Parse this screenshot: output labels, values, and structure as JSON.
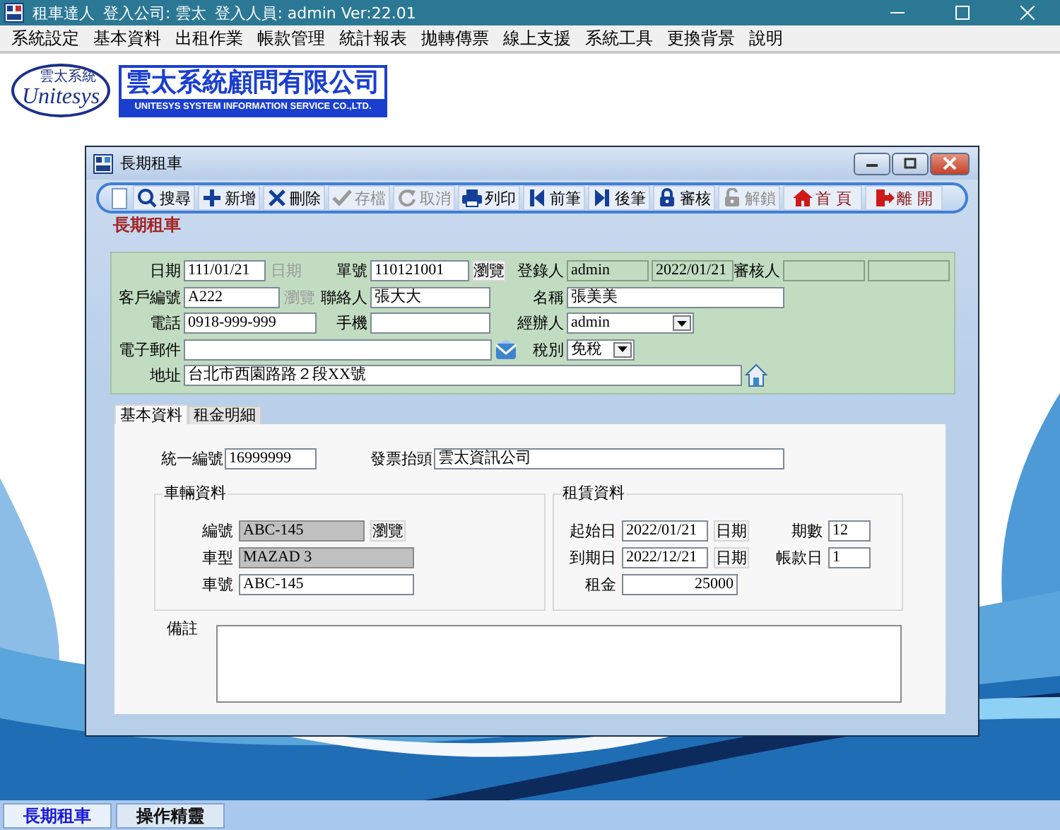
{
  "app": {
    "title": "租車達人",
    "company": "登入公司: 雲太",
    "user": "登入人員: admin Ver:22.01"
  },
  "menu": [
    "系統設定",
    "基本資料",
    "出租作業",
    "帳款管理",
    "統計報表",
    "拋轉傳票",
    "線上支援",
    "系統工具",
    "更換背景",
    "說明"
  ],
  "logo": {
    "badge": "雲太系統",
    "script": "Unitesys",
    "name": "雲太系統顧問有限公司",
    "subtitle": "UNITESYS SYSTEM INFORMATION SERVICE CO.,LTD."
  },
  "window": {
    "title": "長期租車"
  },
  "toolbar": {
    "items": [
      {
        "label": "搜尋",
        "disabled": false
      },
      {
        "label": "新增",
        "disabled": false
      },
      {
        "label": "刪除",
        "disabled": false
      },
      {
        "label": "存檔",
        "disabled": true
      },
      {
        "label": "取消",
        "disabled": true
      },
      {
        "label": "列印",
        "disabled": false
      },
      {
        "label": "前筆",
        "disabled": false
      },
      {
        "label": "後筆",
        "disabled": false
      },
      {
        "label": "審核",
        "disabled": false
      },
      {
        "label": "解鎖",
        "disabled": true
      }
    ],
    "nav": [
      {
        "label": "首 頁"
      },
      {
        "label": "離 開"
      }
    ]
  },
  "heading": "長期租車",
  "header": {
    "rows": [
      {
        "fields": [
          {
            "label": "日期",
            "controls": [
              {
                "kind": "input",
                "value": "111/01/21",
                "readonly": false
              },
              {
                "kind": "button",
                "label": "日期",
                "disabled": true
              }
            ]
          },
          {
            "label": "單號",
            "controls": [
              {
                "kind": "input",
                "value": "110121001",
                "readonly": false
              },
              {
                "kind": "button",
                "label": "瀏覽",
                "disabled": false
              }
            ]
          },
          {
            "label": "登錄人",
            "controls": [
              {
                "kind": "input",
                "value": "admin",
                "readonly": true
              },
              {
                "kind": "input",
                "value": "2022/01/21",
                "readonly": true
              }
            ]
          },
          {
            "label": "審核人",
            "controls": [
              {
                "kind": "input",
                "readonly": true
              },
              {
                "kind": "input",
                "readonly": true
              }
            ]
          }
        ]
      },
      {
        "fields": [
          {
            "label": "客戶編號",
            "controls": [
              {
                "kind": "input",
                "value": "A222",
                "readonly": false
              },
              {
                "kind": "button",
                "label": "瀏覽",
                "disabled": true
              }
            ]
          },
          {
            "label": "聯絡人",
            "controls": [
              {
                "kind": "input",
                "value": "張大大",
                "readonly": false
              }
            ]
          },
          {
            "label": "名稱",
            "controls": [
              {
                "kind": "input",
                "value": "張美美",
                "readonly": false
              }
            ]
          }
        ]
      },
      {
        "fields": [
          {
            "label": "電話",
            "controls": [
              {
                "kind": "input",
                "value": "0918-999-999",
                "readonly": false
              }
            ]
          },
          {
            "label": "手機",
            "controls": [
              {
                "kind": "input",
                "readonly": false
              }
            ]
          },
          {
            "label": "經辦人",
            "controls": [
              {
                "kind": "select",
                "value": "admin"
              }
            ]
          }
        ]
      },
      {
        "fields": [
          {
            "label": "電子郵件",
            "controls": [
              {
                "kind": "input",
                "readonly": false
              }
            ]
          },
          {
            "label": "稅別",
            "controls": [
              {
                "kind": "select",
                "value": "免稅"
              }
            ]
          }
        ]
      },
      {
        "fields": [
          {
            "label": "地址",
            "controls": [
              {
                "kind": "input",
                "value": "台北市西園路路２段XX號",
                "readonly": false
              }
            ]
          }
        ]
      }
    ]
  },
  "tabs": [
    {
      "label": "基本資料",
      "selected": true
    },
    {
      "label": "租金明細",
      "selected": false
    }
  ],
  "basic": {
    "fields": [
      {
        "label": "統一編號",
        "value": "16999999"
      },
      {
        "label": "發票抬頭",
        "value": "雲太資訊公司"
      }
    ],
    "groups": [
      {
        "title": "車輛資料",
        "rows": [
          {
            "fields": [
              {
                "label": "編號",
                "controls": [
                  {
                    "kind": "input",
                    "value": "ABC-145",
                    "readonly": true
                  },
                  {
                    "kind": "button",
                    "label": "瀏覽",
                    "disabled": false
                  }
                ]
              }
            ]
          },
          {
            "fields": [
              {
                "label": "車型",
                "controls": [
                  {
                    "kind": "input",
                    "value": "MAZAD 3",
                    "readonly": true
                  }
                ]
              }
            ]
          },
          {
            "fields": [
              {
                "label": "車號",
                "controls": [
                  {
                    "kind": "input",
                    "value": "ABC-145",
                    "readonly": false
                  }
                ]
              }
            ]
          }
        ]
      },
      {
        "title": "租賃資料",
        "rows": [
          {
            "fields": [
              {
                "label": "起始日",
                "controls": [
                  {
                    "kind": "input",
                    "value": "2022/01/21",
                    "readonly": false
                  },
                  {
                    "kind": "button",
                    "label": "日期",
                    "disabled": false
                  }
                ]
              },
              {
                "label": "期數",
                "controls": [
                  {
                    "kind": "input",
                    "value": "12",
                    "readonly": false
                  }
                ]
              }
            ]
          },
          {
            "fields": [
              {
                "label": "到期日",
                "controls": [
                  {
                    "kind": "input",
                    "value": "2022/12/21",
                    "readonly": false
                  },
                  {
                    "kind": "button",
                    "label": "日期",
                    "disabled": false
                  }
                ]
              },
              {
                "label": "帳款日",
                "controls": [
                  {
                    "kind": "input",
                    "value": "1",
                    "readonly": false
                  }
                ]
              }
            ]
          },
          {
            "fields": [
              {
                "label": "租金",
                "controls": [
                  {
                    "kind": "number",
                    "value": "25000",
                    "readonly": false
                  }
                ]
              }
            ]
          }
        ]
      }
    ],
    "notes": {
      "label": "備註"
    }
  },
  "taskbar": [
    {
      "label": "長期租車",
      "selected": true
    },
    {
      "label": "操作精靈",
      "selected": false
    }
  ]
}
